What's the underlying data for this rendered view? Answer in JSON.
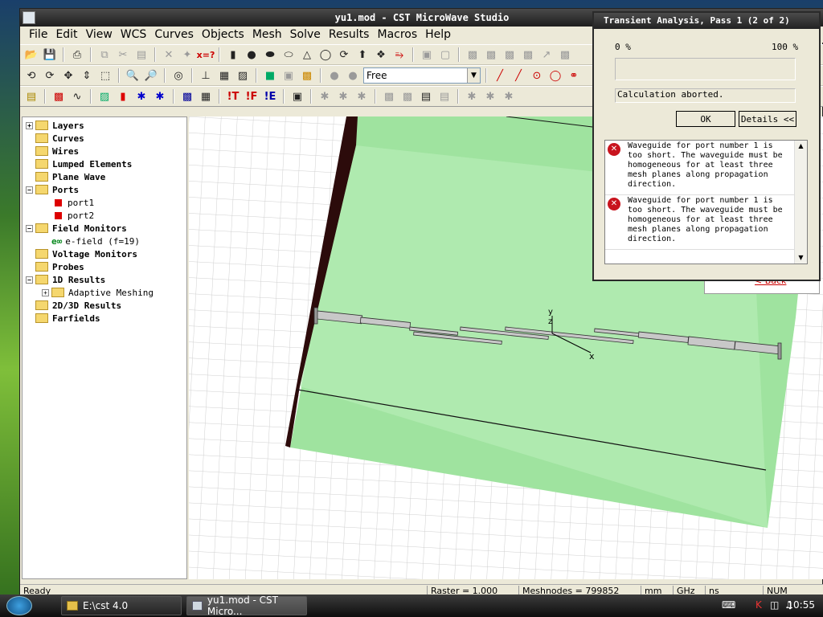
{
  "window": {
    "title": "yu1.mod - CST MicroWave Studio",
    "menu": [
      "File",
      "Edit",
      "View",
      "WCS",
      "Curves",
      "Objects",
      "Mesh",
      "Solve",
      "Results",
      "Macros",
      "Help"
    ]
  },
  "toolbar": {
    "mode_combo_value": "Free"
  },
  "tree": {
    "items": [
      {
        "label": "Layers",
        "bold": true
      },
      {
        "label": "Curves",
        "bold": true
      },
      {
        "label": "Wires",
        "bold": true
      },
      {
        "label": "Lumped Elements",
        "bold": true
      },
      {
        "label": "Plane Wave",
        "bold": true
      },
      {
        "label": "Ports",
        "bold": true
      },
      {
        "label": "port1",
        "bold": false
      },
      {
        "label": "port2",
        "bold": false
      },
      {
        "label": "Field Monitors",
        "bold": true
      },
      {
        "label": "e-field (f=19)",
        "bold": false
      },
      {
        "label": "Voltage Monitors",
        "bold": true
      },
      {
        "label": "Probes",
        "bold": true
      },
      {
        "label": "1D Results",
        "bold": true
      },
      {
        "label": "Adaptive Meshing",
        "bold": false
      },
      {
        "label": "2D/3D Results",
        "bold": true
      },
      {
        "label": "Farfields",
        "bold": true
      }
    ]
  },
  "viewport": {
    "axis_labels": {
      "y": "y",
      "z": "z",
      "x": "x"
    },
    "colors": {
      "substrate": "#b8ecb8",
      "substrate_edge": "#2c0b0b",
      "grid": "#cfcfcf"
    }
  },
  "status": {
    "ready": "Ready",
    "raster": "Raster = 1.000",
    "meshnodes": "Meshnodes = 799852",
    "unit1": "mm",
    "unit2": "GHz",
    "unit3": "ns",
    "num": "NUM"
  },
  "dialog": {
    "title": "Transient Analysis, Pass 1  (2 of 2)",
    "progress_min": "0 %",
    "progress_max": "100 %",
    "progress_fraction": 0,
    "status_text": "Calculation aborted.",
    "ok_label": "OK",
    "details_label": "Details <<",
    "messages": [
      "Waveguide for port number 1 is too short. The waveguide must be homogeneous for at least three mesh planes along propagation direction.",
      "Waveguide for port number 1 is too short. The waveguide must be homogeneous for at least three mesh planes along propagation direction."
    ],
    "behind_link": "< Back"
  },
  "taskbar": {
    "items": [
      "E:\\cst 4.0",
      "yu1.mod - CST Micro..."
    ],
    "clock": "10:55"
  }
}
